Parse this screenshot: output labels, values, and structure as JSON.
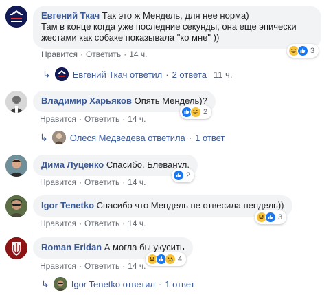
{
  "comments": [
    {
      "author": "Евгений Ткач",
      "text": "Так это ж Мендель, для нее норма)\nТам в конце когда уже последние секунды, она еще эпически жестами как собаке показывала \"ко мне\" ))",
      "like": "Нравится",
      "reply": "Ответить",
      "time": "14 ч.",
      "reaction_count": "3",
      "reactions": [
        "haha",
        "like"
      ],
      "replies": {
        "name": "Евгений Ткач ответил",
        "count": "2 ответа",
        "time": "11 ч."
      }
    },
    {
      "author": "Владимир Харьяков",
      "text": "Опять Мендель)?",
      "like": "Нравится",
      "reply": "Ответить",
      "time": "14 ч.",
      "reaction_count": "2",
      "reactions": [
        "like",
        "haha"
      ],
      "replies": {
        "name": "Олеся Медведева ответила",
        "count": "1 ответ"
      }
    },
    {
      "author": "Дима Луценко",
      "text": "Спасибо. Блеванул.",
      "like": "Нравится",
      "reply": "Ответить",
      "time": "14 ч.",
      "reaction_count": "2",
      "reactions": [
        "like"
      ]
    },
    {
      "author": "Igor Tenetko",
      "text": "Спасибо что Мендель не отвесила пендель))",
      "like": "Нравится",
      "reply": "Ответить",
      "time": "14 ч.",
      "reaction_count": "3",
      "reactions": [
        "haha",
        "like"
      ]
    },
    {
      "author": "Roman Eridan",
      "text": "А могла бы укусить",
      "like": "Нравится",
      "reply": "Ответить",
      "time": "14 ч.",
      "reaction_count": "4",
      "reactions": [
        "haha",
        "like",
        "sad"
      ],
      "replies": {
        "name": "Igor Tenetko ответил",
        "count": "1 ответ"
      }
    }
  ],
  "colors": {
    "link": "#385898",
    "bubble": "#f2f3f5",
    "meta": "#606770",
    "like": "#1877f2",
    "haha": "#f7c33a"
  },
  "icons": {
    "reply_arrow": "reply-arrow-icon",
    "haha": "haha-reaction-icon",
    "like": "like-reaction-icon",
    "sad": "sad-reaction-icon"
  }
}
